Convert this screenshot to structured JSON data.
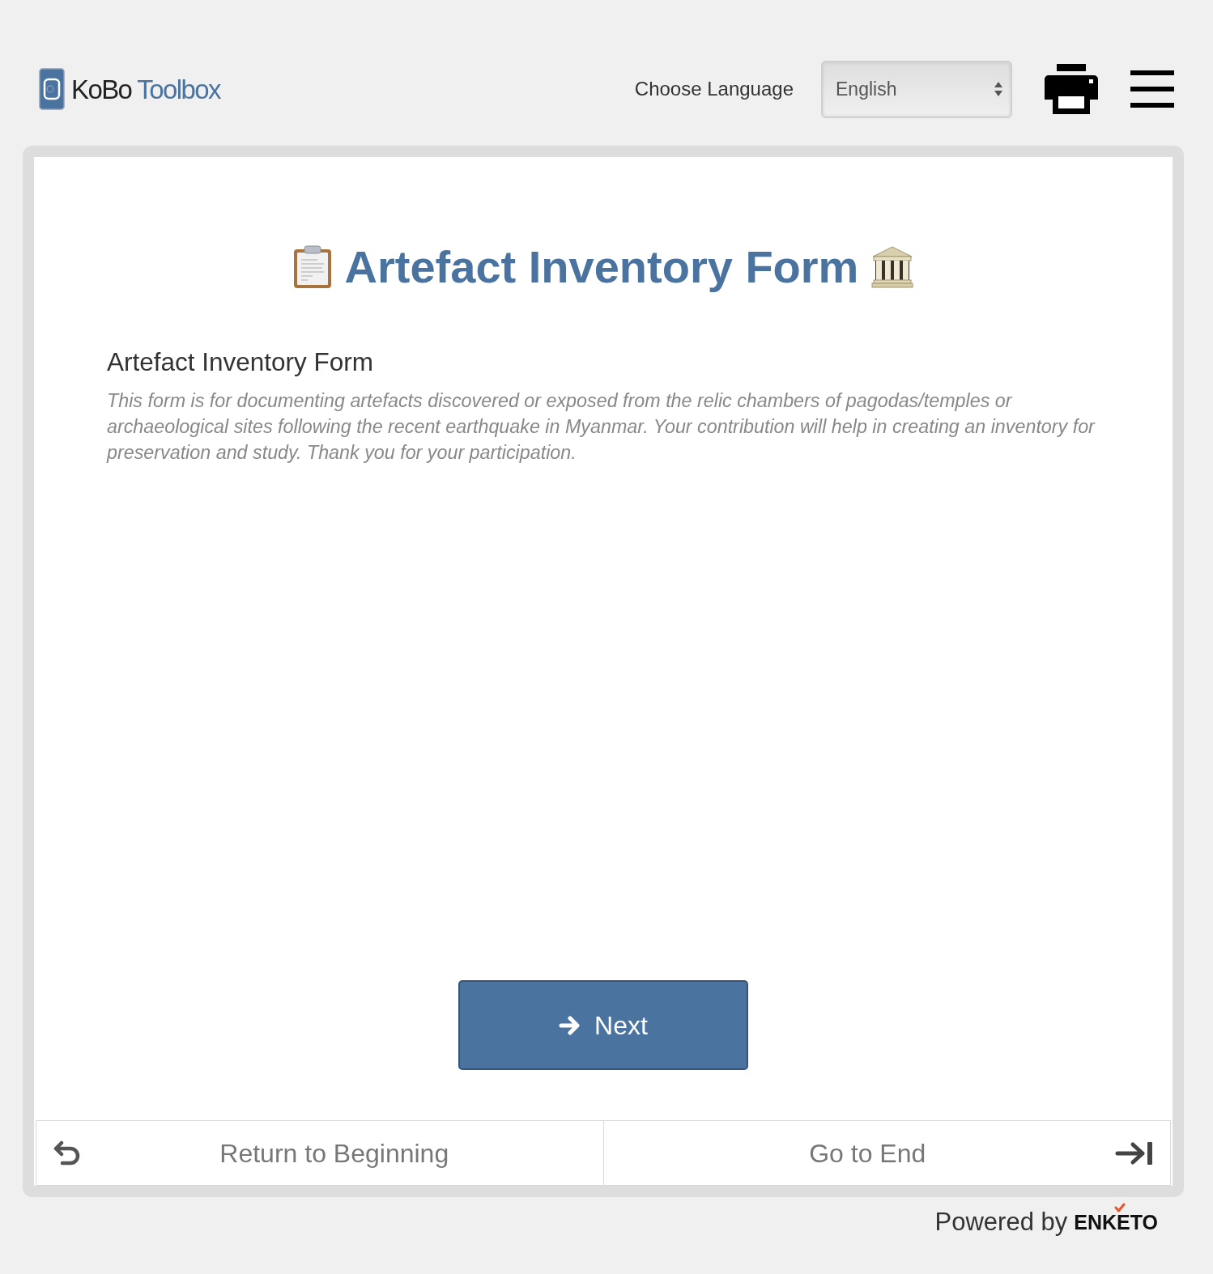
{
  "header": {
    "logo": {
      "name": "KoBo",
      "product": "Toolbox"
    },
    "language": {
      "label": "Choose Language",
      "value": "English"
    }
  },
  "form": {
    "title": "Artefact Inventory Form",
    "heading": "Artefact Inventory Form",
    "description": "This form is for documenting artefacts discovered or exposed from the relic chambers of pagodas/temples or archaeological sites following the recent earthquake in Myanmar. Your contribution will help in creating an inventory for preservation and study. Thank you for your participation."
  },
  "next_button": {
    "label": "Next"
  },
  "footer_nav": [
    {
      "label": "Return to Beginning",
      "kind": "start"
    },
    {
      "label": "Go to End",
      "kind": "end"
    }
  ],
  "powered_by": {
    "text": "Powered by",
    "brand": "ENKETO"
  }
}
